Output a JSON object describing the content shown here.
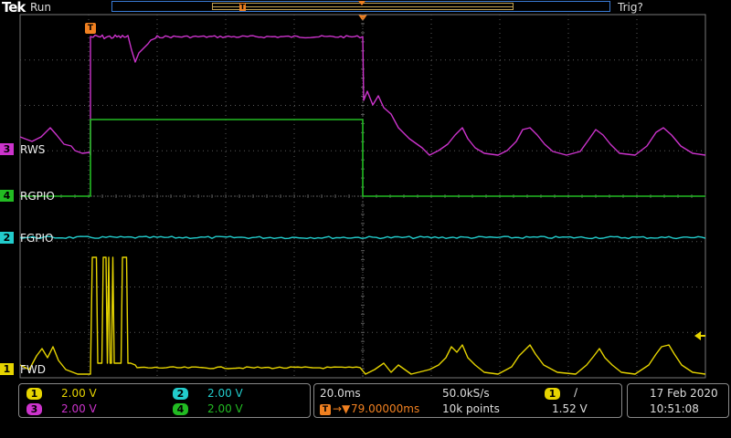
{
  "header": {
    "logo": "Tek",
    "run_status": "Run",
    "trigger_status": "Trig?"
  },
  "markers": {
    "trigger_flag": "T",
    "record_marker": "T"
  },
  "channels": [
    {
      "number": "3",
      "label": "RWS",
      "color": "#cc33cc"
    },
    {
      "number": "4",
      "label": "RGPIO",
      "color": "#22bb22"
    },
    {
      "number": "2",
      "label": "FGPIO",
      "color": "#22cccc"
    },
    {
      "number": "1",
      "label": "FWD",
      "color": "#e6d400"
    }
  ],
  "vertical": {
    "ch1": {
      "num": "1",
      "scale": "2.00 V"
    },
    "ch2": {
      "num": "2",
      "scale": "2.00 V"
    },
    "ch3": {
      "num": "3",
      "scale": "2.00 V"
    },
    "ch4": {
      "num": "4",
      "scale": "2.00 V"
    }
  },
  "horizontal": {
    "timebase": "20.0ms",
    "sample_rate": "50.0kS/s",
    "trig_position": "79.00000ms",
    "record_length": "10k points"
  },
  "trigger": {
    "source": "1",
    "slope_symbol": "∕",
    "level": "1.52 V"
  },
  "datetime": {
    "date": "17 Feb  2020",
    "time": "10:51:08"
  },
  "colors": {
    "ch1": "#e6d400",
    "ch2": "#22cccc",
    "ch3": "#cc33cc",
    "ch4": "#22bb22",
    "trigger": "#f08020",
    "grid": "#5a5a5a"
  }
}
